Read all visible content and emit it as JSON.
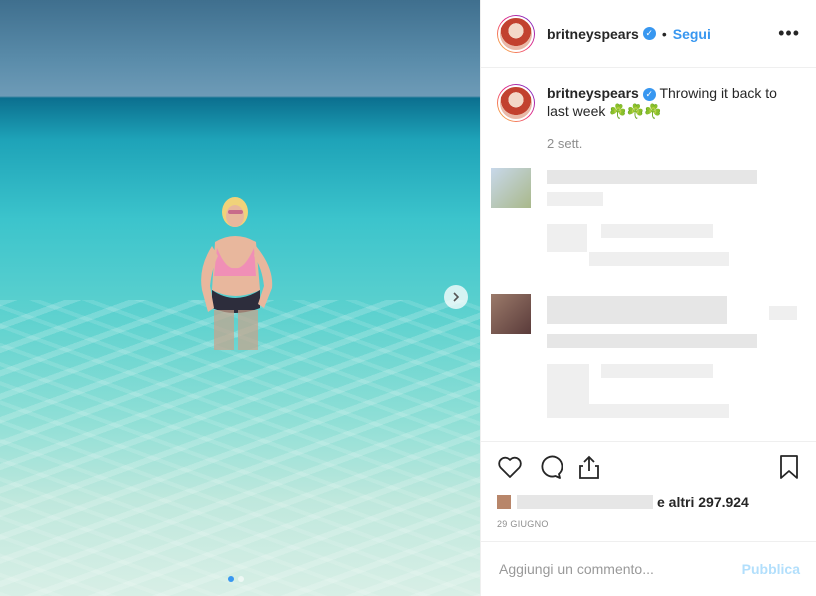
{
  "header": {
    "username": "britneyspears",
    "verified_icon": "verified-badge-icon",
    "separator": "•",
    "follow_label": "Segui",
    "more_label": "•••"
  },
  "caption": {
    "username": "britneyspears",
    "text": "Throwing it back to last week ☘️☘️☘️",
    "time": "2 sett."
  },
  "actions": {
    "like_icon": "heart-icon",
    "comment_icon": "comment-icon",
    "share_icon": "share-icon",
    "save_icon": "bookmark-icon"
  },
  "likes": {
    "suffix": "e altri 297.924"
  },
  "date": "29 GIUGNO",
  "comment_box": {
    "placeholder": "Aggiungi un commento...",
    "publish_label": "Pubblica"
  },
  "colors": {
    "accent": "#3897f0",
    "publish_disabled": "#b2dffc"
  }
}
